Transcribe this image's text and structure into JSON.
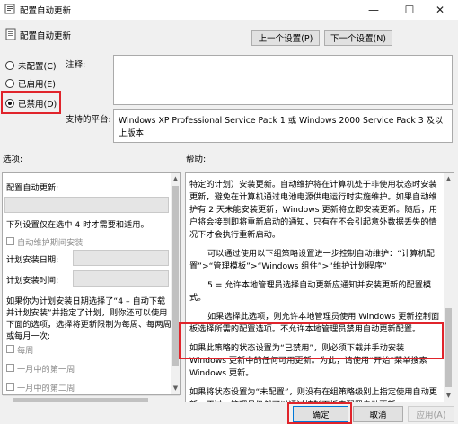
{
  "window": {
    "title": "配置自动更新",
    "minimize_glyph": "—",
    "maximize_glyph": "☐",
    "close_glyph": "✕"
  },
  "header": {
    "title": "配置自动更新",
    "prev_label": "上一个设置(P)",
    "next_label": "下一个设置(N)"
  },
  "state": {
    "options": [
      {
        "label": "未配置(C)",
        "checked": false
      },
      {
        "label": "已启用(E)",
        "checked": false
      },
      {
        "label": "已禁用(D)",
        "checked": true
      }
    ]
  },
  "comment": {
    "label": "注释:",
    "value": ""
  },
  "supported": {
    "label": "支持的平台:",
    "value": "Windows XP Professional Service Pack 1 或 Windows 2000 Service Pack 3 及以上版本"
  },
  "sections": {
    "options_label": "选项:",
    "help_label": "帮助:"
  },
  "options_panel": {
    "configure_label": "配置自动更新:",
    "install_note": "下列设置仅在选中 4 时才需要和适用。",
    "maintenance_checkbox": "自动维护期间安装",
    "install_day_label": "计划安装日期:",
    "install_time_label": "计划安装时间:",
    "para_lines": [
      "如果你为计划安装日期选择了“4 – 自动下载",
      "并计划安装”并指定了计划，则你还可以使用",
      "下面的选项，选择将更新限制为每周、每两周",
      "或每月一次:"
    ],
    "weekly": "每周",
    "first_week": "一月中的第一周",
    "second_week": "一月中的第二周"
  },
  "help": {
    "paragraphs": [
      "特定的计划）安装更新。自动维护将在计算机处于非使用状态时安装更新，避免在计算机通过电池电源供电运行时实施维护。如果自动维护有 2 天未能安装更新，Windows 更新将立即安装更新。随后，用户将会接到即将重新启动的通知，只有在不会引起意外数据丢失的情况下才会执行重新启动。",
      "可以通过使用以下组策略设置进一步控制自动维护：“计算机配置”>“管理模板”>“Windows 组件”>“维护计划程序”",
      "5 = 允许本地管理员选择自动更新应通知并安装更新的配置模式。",
      "如果选择此选项，则允许本地管理员使用 Windows 更新控制面板选择所需的配置选项。不允许本地管理员禁用自动更新配置。",
      "如果此策略的状态设置为“已禁用”，则必须下载并手动安装 Windows 更新中的任何可用更新。为此，请使用“开始”菜单搜索 Windows 更新。",
      "如果将状态设置为“未配置”，则没有在组策略级别上指定使用自动更新。不过，管理员仍然可以通过控制面板来配置自动更新。"
    ]
  },
  "footer": {
    "ok_label": "确定",
    "cancel_label": "取消",
    "apply_label": "应用(A)"
  },
  "colors": {
    "highlight": "#e0242b",
    "focus_border": "#0078d7"
  }
}
